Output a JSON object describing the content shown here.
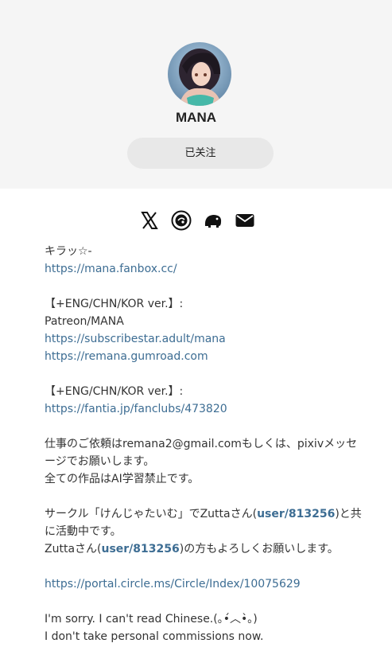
{
  "profile": {
    "username": "MANA",
    "follow_label": "已关注"
  },
  "social_icons": [
    "x-icon",
    "circle-icon",
    "elephant-icon",
    "mail-icon"
  ],
  "bio": {
    "l1": "キラッ☆-",
    "l2": "https://mana.fanbox.cc/",
    "l3": "【+ENG/CHN/KOR ver.】:",
    "l4": "Patreon/MANA",
    "l5": "https://subscribestar.adult/mana",
    "l6": "https://remana.gumroad.com",
    "l7": "【+ENG/CHN/KOR ver.】:",
    "l8": "https://fantia.jp/fanclubs/473820",
    "l9": "仕事のご依頼はremana2@gmail.comもしくは、pixivメッセ",
    "l10": "ージでお願いします。",
    "l11": "全ての作品はAI学習禁止です。",
    "l12a": "サークル「けんじゃたいむ」でZuttaさん(",
    "l12b": "user/813256",
    "l12c": ")と共",
    "l13": "に活動中です。",
    "l14a": "Zuttaさん(",
    "l14b": "user/813256",
    "l14c": ")の方もよろしくお願いします。",
    "l15": "https://portal.circle.ms/Circle/Index/10075629",
    "l16": "I'm sorry. I can't read Chinese.(｡•́︿•̀｡)",
    "l17": "I don't take personal commissions now."
  }
}
